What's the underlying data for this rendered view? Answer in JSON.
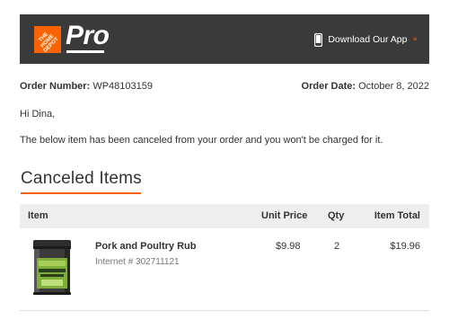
{
  "header": {
    "brand_logo_text": "THE HOME DEPOT",
    "pro_label": "Pro",
    "download_label": "Download Our App",
    "download_chevron": "»",
    "phone_icon": "phone-icon",
    "background_color": "#3a3a3a",
    "accent_color": "#f96302"
  },
  "order": {
    "number_label": "Order Number:",
    "number_value": "WP48103159",
    "date_label": "Order Date:",
    "date_value": "October 8, 2022"
  },
  "greeting": "Hi Dina,",
  "message": "The below item has been canceled from your order and you won't be charged for it.",
  "section": {
    "title": "Canceled Items",
    "underline_color": "#f96302"
  },
  "table": {
    "headers": {
      "item": "Item",
      "unit_price": "Unit Price",
      "qty": "Qty",
      "item_total": "Item Total"
    },
    "rows": [
      {
        "name": "Pork and Poultry Rub",
        "sku": "Internet # 302711121",
        "unit_price": "$9.98",
        "qty": "2",
        "item_total": "$19.96",
        "image": "spice-tin-image"
      }
    ]
  }
}
